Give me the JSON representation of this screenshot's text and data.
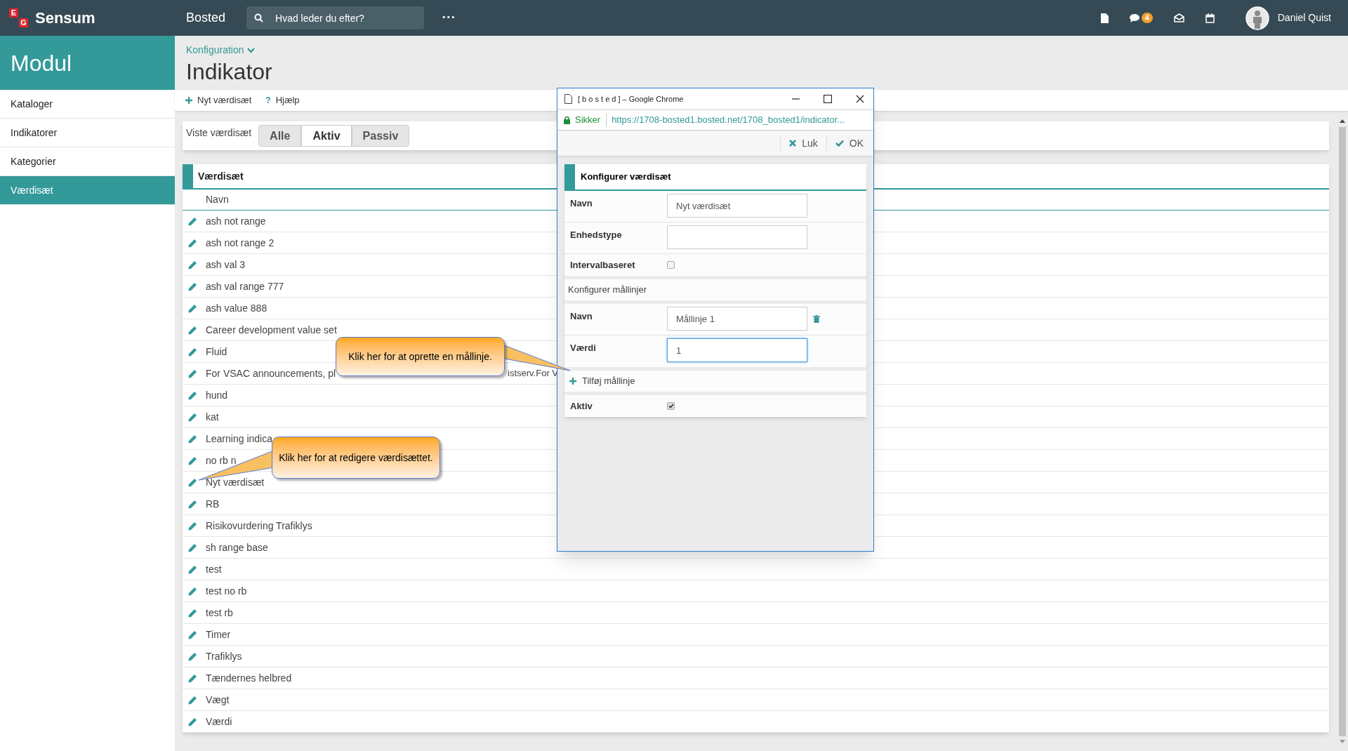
{
  "app": {
    "logo_letters": [
      "E",
      "G"
    ],
    "logo_text": "Sensum",
    "module": "Bosted",
    "search": {
      "placeholder": "Hvad leder du efter?"
    },
    "more": "•••",
    "messages_badge": "4",
    "user": "Daniel Quist"
  },
  "sidebar": {
    "title": "Modul",
    "items": [
      {
        "label": "Kataloger",
        "selected": false
      },
      {
        "label": "Indikatorer",
        "selected": false
      },
      {
        "label": "Kategorier",
        "selected": false
      },
      {
        "label": "Værdisæt",
        "selected": true
      }
    ]
  },
  "breadcrumb": "Konfiguration",
  "page_title": "Indikator",
  "toolbar": [
    {
      "kind": "plus",
      "label": "Nyt værdisæt"
    },
    {
      "kind": "help",
      "glyph": "?",
      "label": "Hjælp"
    }
  ],
  "filter": {
    "label": "Viste værdisæt",
    "options": [
      {
        "label": "Alle",
        "selected": false
      },
      {
        "label": "Aktiv",
        "selected": true
      },
      {
        "label": "Passiv",
        "selected": false
      }
    ]
  },
  "table": {
    "title": "Værdisæt",
    "columns": [
      "Navn"
    ],
    "rows": [
      "ash not range",
      "ash not range 2",
      "ash val 3",
      "ash val range 777",
      "ash value 888",
      "Career development value set",
      "Fluid",
      {
        "name": "For VSAC announcements, pl",
        "tail": "istserv.For V"
      },
      "hund",
      "kat",
      "Learning indica",
      "no rb n",
      "Nyt værdisæt",
      "RB",
      "Risikovurdering Trafiklys",
      "sh range base",
      "test",
      "test no rb",
      "test rb",
      "Timer",
      "Trafiklys",
      "Tændernes helbred",
      "Vægt",
      "Værdi"
    ]
  },
  "popup": {
    "window_title": "[ b o s t e d ] – Google Chrome",
    "secure_label": "Sikker",
    "url": "https://1708-bosted1.bosted.net/1708_bosted1/indicator...",
    "actions": [
      {
        "kind": "close",
        "label": "Luk"
      },
      {
        "kind": "ok",
        "label": "OK"
      }
    ],
    "form": {
      "title": "Konfigurer værdisæt",
      "fields": [
        {
          "kind": "text",
          "label": "Navn",
          "value": "Nyt værdisæt"
        },
        {
          "kind": "text",
          "label": "Enhedstype"
        },
        {
          "kind": "checkbox",
          "label": "Intervalbaseret",
          "checked": false
        }
      ],
      "section": "Konfigurer mållinjer",
      "targets": [
        {
          "kind": "text",
          "label": "Navn",
          "value": "Mållinje 1",
          "deletable": true,
          "focused": false
        },
        {
          "kind": "text",
          "label": "Værdi",
          "value": "1",
          "deletable": false,
          "focused": true
        }
      ],
      "add_label": "Tilføj mållinje",
      "active": {
        "kind": "checkbox",
        "label": "Aktiv",
        "checked": true
      }
    }
  },
  "callouts": [
    {
      "text": "Klik her for at oprette en mållinje."
    },
    {
      "text": "Klik her for at redigere værdisættet."
    }
  ]
}
